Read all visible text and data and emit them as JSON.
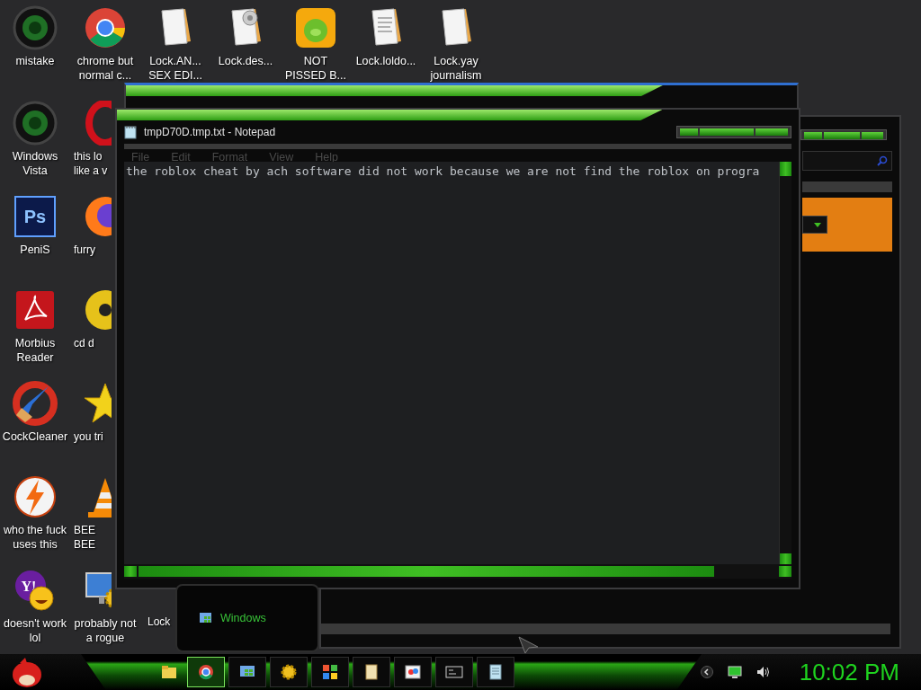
{
  "desktop_icons": [
    [
      {
        "kind": "wheel",
        "label": [
          "mistake"
        ]
      },
      {
        "kind": "ring",
        "label": [
          "chrome but",
          "normal c..."
        ]
      },
      {
        "kind": "document",
        "label": [
          "Lock.AN...",
          "SEX EDI..."
        ]
      },
      {
        "kind": "document-gear",
        "label": [
          "Lock.des..."
        ]
      },
      {
        "kind": "pig-app",
        "label": [
          "NOT",
          "PISSED B..."
        ]
      },
      {
        "kind": "document-lines",
        "label": [
          "Lock.loldo..."
        ]
      },
      {
        "kind": "document",
        "label": [
          "Lock.yay",
          "journalism"
        ]
      }
    ],
    [
      {
        "kind": "wheel",
        "label": [
          "Windows",
          "Vista"
        ]
      },
      {
        "kind": "red-ring",
        "label": [
          "this lo",
          "like a v"
        ]
      }
    ],
    [
      {
        "kind": "square-logo",
        "glyph": "Ps",
        "label": [
          "PeniS"
        ]
      },
      {
        "kind": "fox",
        "label": [
          "furry"
        ]
      }
    ],
    [
      {
        "kind": "pdf",
        "label": [
          "Morbius",
          "Reader"
        ]
      },
      {
        "kind": "disc",
        "label": [
          "cd d"
        ]
      }
    ],
    [
      {
        "kind": "brush",
        "label": [
          "CockCleaner"
        ]
      },
      {
        "kind": "star",
        "label": [
          "you tri"
        ]
      }
    ],
    [
      {
        "kind": "bolt",
        "label": [
          "who the fuck",
          "uses this"
        ]
      },
      {
        "kind": "cone",
        "label": [
          "BEE",
          "BEE"
        ]
      }
    ],
    [
      {
        "kind": "smiley",
        "glyph": "Y!",
        "label": [
          "doesn't work",
          "lol"
        ]
      },
      {
        "kind": "monitor-gear",
        "label": [
          "probably not",
          "a rogue"
        ]
      },
      {
        "kind": "none",
        "label": [
          "Lock"
        ]
      }
    ]
  ],
  "notepad": {
    "title": "tmpD70D.tmp.txt - Notepad",
    "menu": [
      "File",
      "Edit",
      "Format",
      "View",
      "Help"
    ],
    "text": "the roblox cheat by ach software did not work because we are not find the roblox on progra"
  },
  "taskbar": {
    "popup": {
      "label": "Windows"
    },
    "buttons": [
      {
        "kind": "folder",
        "selected": false
      },
      {
        "kind": "ring",
        "selected": true
      },
      {
        "kind": "flag-window",
        "selected": false
      },
      {
        "kind": "gear",
        "selected": false
      },
      {
        "kind": "tiles",
        "selected": false
      },
      {
        "kind": "note",
        "selected": false
      },
      {
        "kind": "paint",
        "selected": false
      },
      {
        "kind": "console",
        "selected": false
      },
      {
        "kind": "notebook",
        "selected": false
      }
    ],
    "clock": "10:02 PM"
  }
}
